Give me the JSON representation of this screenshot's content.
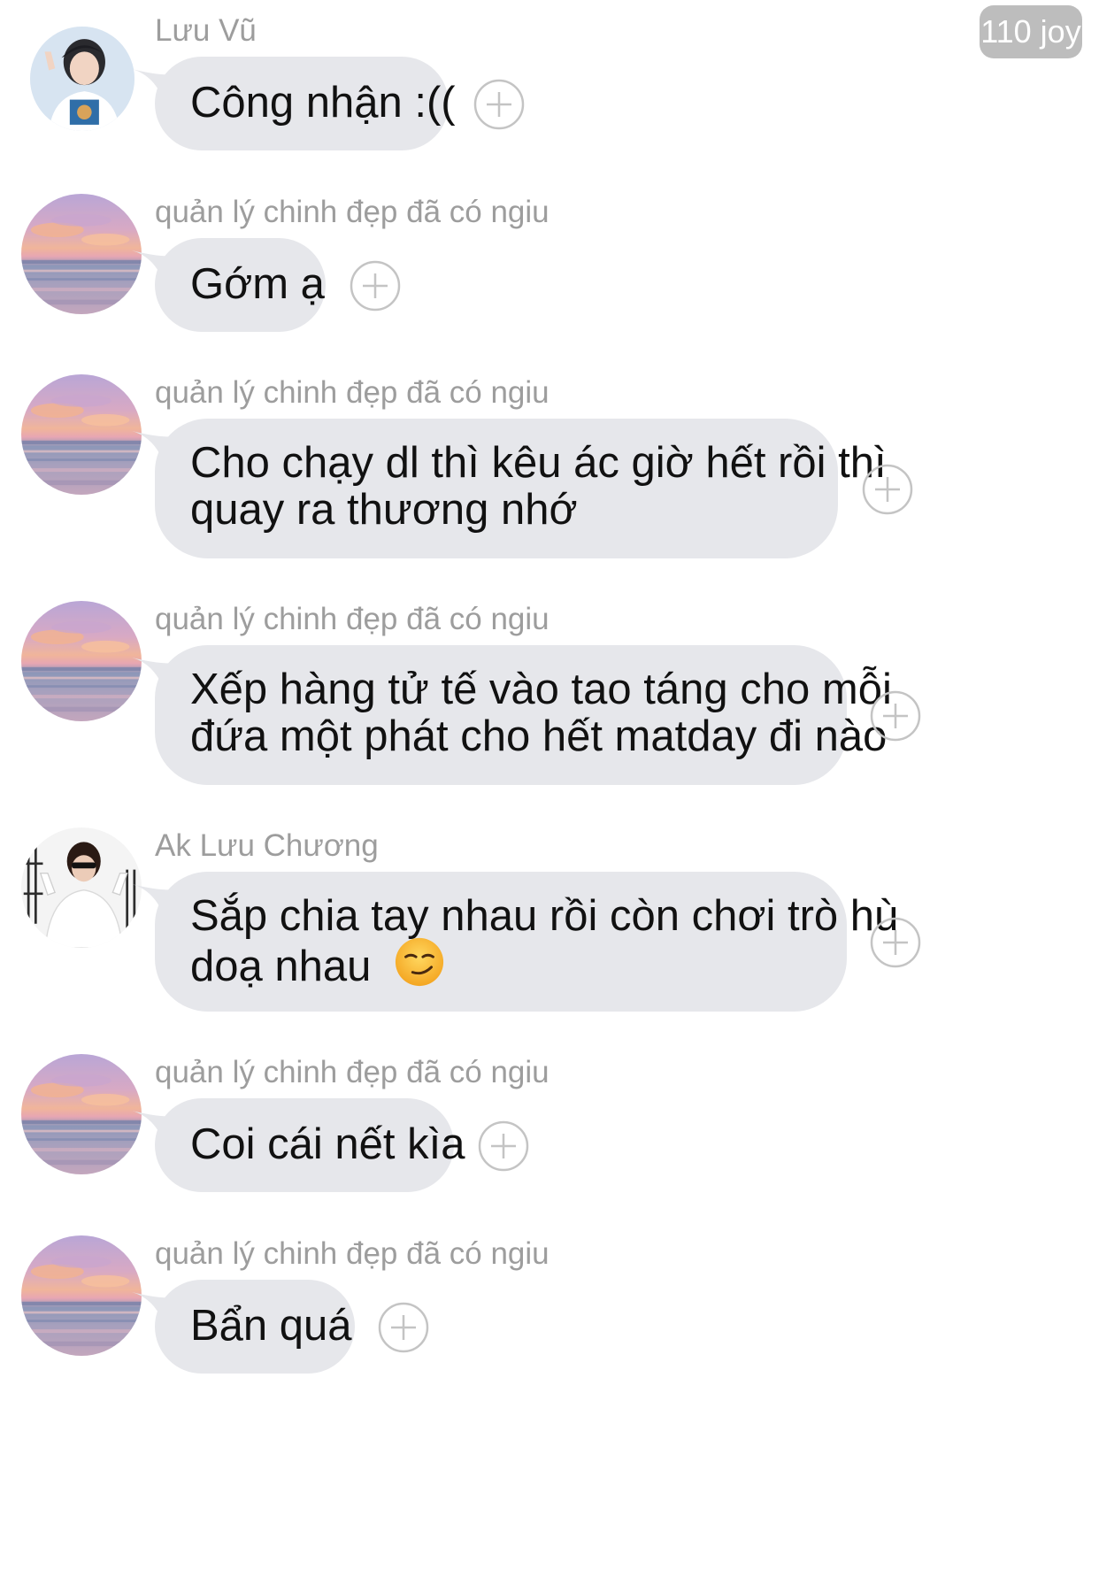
{
  "badge": "110 joy",
  "messages": [
    {
      "sender": "Lưu Vũ",
      "text": "Công nhận :(("
    },
    {
      "sender": "quản lý chinh đẹp đã có ngiu",
      "text": "Gớm ạ"
    },
    {
      "sender": "quản lý chinh đẹp đã có ngiu",
      "lines": [
        "Cho chạy dl thì kêu ác giờ hết rồi thì",
        "quay ra thương nhớ"
      ]
    },
    {
      "sender": "quản lý chinh đẹp đã có ngiu",
      "lines": [
        "Xếp hàng tử tế vào tao táng cho mỗi",
        "đứa một phát cho hết matday đi nào"
      ]
    },
    {
      "sender": "Ak Lưu Chương",
      "lines": [
        "Sắp chia tay nhau rồi còn chơi trò hù",
        "doạ nhau"
      ],
      "emoji": "smirking-face-emoji"
    },
    {
      "sender": "quản lý chinh đẹp đã có ngiu",
      "text": "Coi cái nết kìa"
    },
    {
      "sender": "quản lý chinh đẹp đã có ngiu",
      "text": "Bẩn quá"
    }
  ],
  "colors": {
    "bubble": "#e6e7eb",
    "sender_text": "#9d9d9d",
    "badge_bg": "#bdbdbd",
    "plus_icon": "#c4c4c4"
  },
  "icons": {
    "reaction": "add-reaction-icon"
  }
}
